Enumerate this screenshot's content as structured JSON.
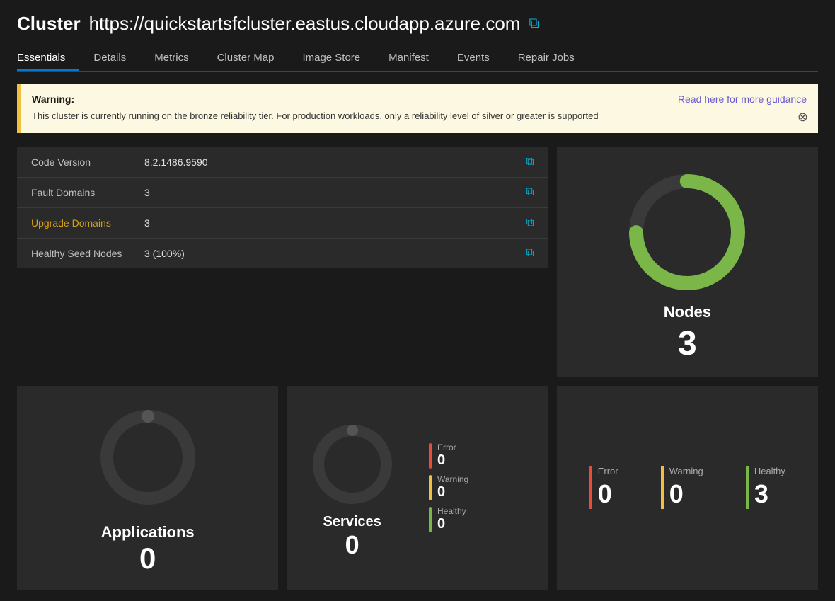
{
  "header": {
    "cluster_prefix": "Cluster",
    "cluster_url": "https://quickstartsfcluster.eastus.cloudapp.azure.com"
  },
  "nav": {
    "tabs": [
      {
        "label": "Essentials",
        "active": true
      },
      {
        "label": "Details",
        "active": false
      },
      {
        "label": "Metrics",
        "active": false
      },
      {
        "label": "Cluster Map",
        "active": false
      },
      {
        "label": "Image Store",
        "active": false
      },
      {
        "label": "Manifest",
        "active": false
      },
      {
        "label": "Events",
        "active": false
      },
      {
        "label": "Repair Jobs",
        "active": false
      }
    ]
  },
  "warning": {
    "label": "Warning:",
    "text": "This cluster is currently running on the bronze reliability tier. For production workloads, only a reliability level of silver or greater is supported",
    "link_text": "Read here for more guidance"
  },
  "info": {
    "rows": [
      {
        "label": "Code Version",
        "value": "8.2.1486.9590",
        "warning": false
      },
      {
        "label": "Fault Domains",
        "value": "3",
        "warning": false
      },
      {
        "label": "Upgrade Domains",
        "value": "3",
        "warning": true
      },
      {
        "label": "Healthy Seed Nodes",
        "value": "3 (100%)",
        "warning": false
      }
    ]
  },
  "nodes": {
    "label": "Nodes",
    "count": "3",
    "donut_color": "#7ab648",
    "donut_bg": "#3a3a3a"
  },
  "applications": {
    "label": "Applications",
    "count": "0",
    "donut_color": "#555",
    "donut_bg": "#3a3a3a"
  },
  "services": {
    "label": "Services",
    "count": "0",
    "error_label": "Error",
    "error_value": "0",
    "warning_label": "Warning",
    "warning_value": "0",
    "healthy_label": "Healthy",
    "healthy_value": "0"
  },
  "node_stats": {
    "error_label": "Error",
    "error_value": "0",
    "warning_label": "Warning",
    "warning_value": "0",
    "healthy_label": "Healthy",
    "healthy_value": "3"
  }
}
